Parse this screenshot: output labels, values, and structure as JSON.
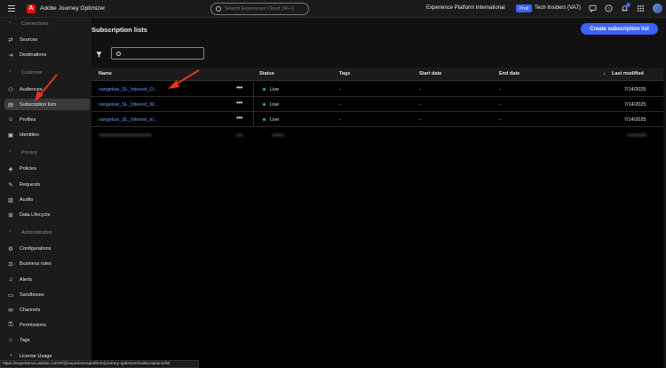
{
  "topbar": {
    "app_title": "Adobe Journey Optimizer",
    "search_placeholder": "Search Experience Cloud (⌘+/)",
    "org_name": "Experience Platform International",
    "env_badge": "Prod",
    "sandbox_name": "Tech Insiders (VA7)"
  },
  "sidebar": {
    "sections": {
      "connections": "Connections",
      "customer": "Customer",
      "privacy": "Privacy",
      "administration": "Administration"
    },
    "items": {
      "sources": "Sources",
      "destinations": "Destinations",
      "audiences": "Audiences",
      "subscription_lists": "Subscription lists",
      "profiles": "Profiles",
      "identities": "Identities",
      "policies": "Policies",
      "requests": "Requests",
      "audits": "Audits",
      "data_lifecycle": "Data Lifecycle",
      "configurations": "Configurations",
      "business_rules": "Business rules",
      "alerts": "Alerts",
      "sandboxes": "Sandboxes",
      "channels": "Channels",
      "permissions": "Permissions",
      "tags": "Tags",
      "license_usage": "License Usage"
    }
  },
  "main": {
    "title": "Subscription lists",
    "create_button": "Create subscription list",
    "columns": {
      "name": "Name",
      "status": "Status",
      "tags": "Tags",
      "start_date": "Start date",
      "end_date": "End date",
      "last_modified": "Last modified"
    },
    "sort_indicator": "↓",
    "rows": [
      {
        "name": "vangeluw_SL_Interest_O...",
        "status": "Live",
        "tags": "-",
        "start": "-",
        "end": "-",
        "modified": "7/14/2025"
      },
      {
        "name": "vangeluw_SL_Interest_W...",
        "status": "Live",
        "tags": "-",
        "start": "-",
        "end": "-",
        "modified": "7/14/2025"
      },
      {
        "name": "vangeluw_SL_Interest_in...",
        "status": "Live",
        "tags": "-",
        "start": "-",
        "end": "-",
        "modified": "7/14/2025"
      }
    ],
    "more_actions": "•••"
  },
  "statusbar": {
    "url": "https://experience.adobe.com/#/@experienceplatform/journey-optimizer/subscriptions/list"
  },
  "colors": {
    "accent": "#3b63fb",
    "link": "#6e9cff",
    "live": "#2dbd7a",
    "annotation_arrow": "#e8321e"
  }
}
